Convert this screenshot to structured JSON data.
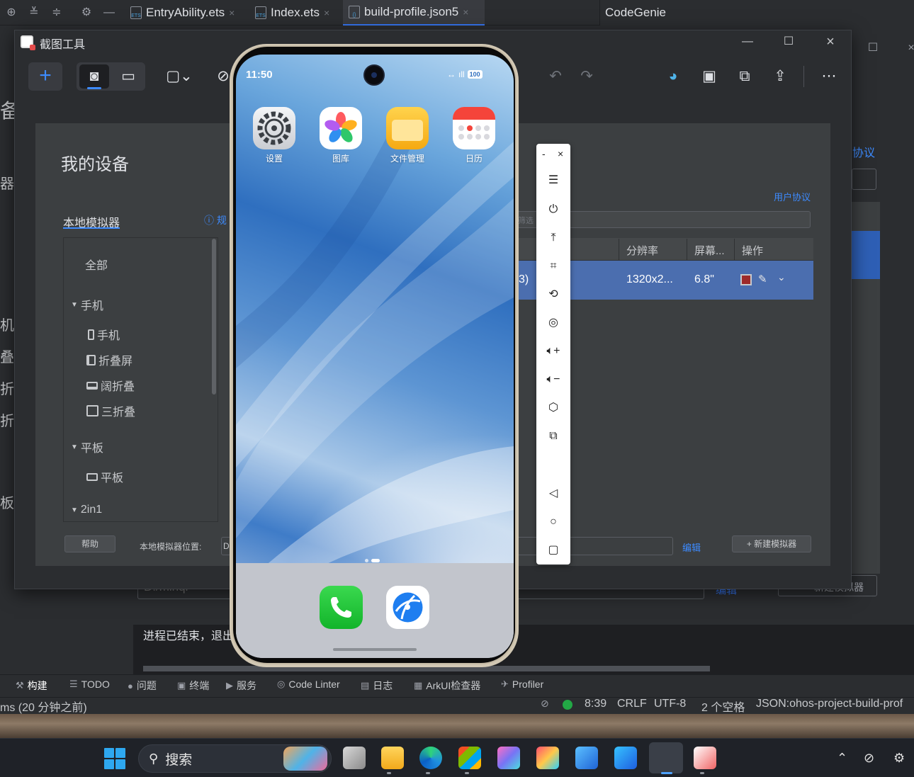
{
  "ide": {
    "tabs": [
      {
        "label": "EntryAbility.ets",
        "active": false
      },
      {
        "label": "Index.ets",
        "active": false
      },
      {
        "label": "build-profile.json5",
        "active": true
      }
    ],
    "right_panel_title": "CodeGenie",
    "tab_icon_badge": "ETS",
    "bg_fragments": {
      "b1": "备",
      "b2": "器",
      "b3": "机",
      "b4": "叠",
      "b5": "折",
      "b6": "折",
      "b7": "板",
      "right_agreement": "协议"
    },
    "bg_location_value": "D:/minqi",
    "bg_edit": "编辑",
    "bg_new": "新建模拟器",
    "console_text": "进程已结束，退出",
    "tool_windows": [
      {
        "icon": "hammer-icon",
        "label": "构建",
        "active": true
      },
      {
        "icon": "list-icon",
        "label": "TODO"
      },
      {
        "icon": "problem-icon",
        "label": "问题"
      },
      {
        "icon": "terminal-icon",
        "label": "终端"
      },
      {
        "icon": "services-icon",
        "label": "服务"
      },
      {
        "icon": "code-linter-icon",
        "label": "Code Linter"
      },
      {
        "icon": "log-icon",
        "label": "日志"
      },
      {
        "icon": "arkui-inspector-icon",
        "label": "ArkUI检查器"
      },
      {
        "icon": "profiler-icon",
        "label": "Profiler"
      }
    ],
    "status": {
      "left": "ms (20 分钟之前)",
      "position": "8:39",
      "line_ending": "CRLF",
      "encoding": "UTF-8",
      "indent": "2 个空格",
      "schema": "JSON:ohos-project-build-prof"
    }
  },
  "snip_tool": {
    "title": "截图工具",
    "toolbar": {
      "new": "+",
      "tools": [
        "camera-icon",
        "video-icon",
        "snip-mode-icon",
        "delay-icon",
        "undo-icon",
        "redo-icon",
        "paint-icon",
        "save-icon",
        "copy-icon",
        "share-icon",
        "more-icon"
      ]
    }
  },
  "device_manager": {
    "title": "我的设备",
    "tab": "本地模拟器",
    "help_link": "规",
    "user_agreement": "用户协议",
    "filter_placeholder": "筛选",
    "tree": {
      "all": "全部",
      "groups": [
        {
          "label": "手机",
          "items": [
            "手机",
            "折叠屏",
            "阔折叠",
            "三折叠"
          ]
        },
        {
          "label": "平板",
          "items": [
            "平板"
          ]
        },
        {
          "label": "2in1",
          "items": []
        }
      ]
    },
    "table": {
      "columns": [
        "分辨率",
        "屏幕...",
        "操作"
      ],
      "row": {
        "name_fragment": "3)",
        "resolution": "1320x2...",
        "screen": "6.8\""
      }
    },
    "help_button": "帮助",
    "location_label": "本地模拟器位置:",
    "location_value": "D",
    "edit": "编辑",
    "new_button": "+ 新建模拟器"
  },
  "phone": {
    "time": "11:50",
    "battery": "100",
    "apps": [
      {
        "label": "设置",
        "icon": "settings-icon"
      },
      {
        "label": "图库",
        "icon": "gallery-icon"
      },
      {
        "label": "文件管理",
        "icon": "files-icon"
      },
      {
        "label": "日历",
        "icon": "calendar-icon"
      }
    ],
    "dock": [
      "phone-icon",
      "browser-icon"
    ]
  },
  "emulator_toolbar": {
    "top": [
      "-",
      "×"
    ],
    "buttons": [
      "menu-icon",
      "power-icon",
      "pin-top-icon",
      "crop-icon",
      "rotate-icon",
      "screen-record-icon",
      "volume-up-icon",
      "volume-down-icon",
      "shake-icon",
      "fold-icon",
      "back-icon",
      "home-icon",
      "recents-icon"
    ]
  },
  "taskbar": {
    "search": "搜索",
    "apps": [
      "task-view-icon",
      "file-explorer-icon",
      "edge-icon",
      "store-icon",
      "app-icon-1",
      "app-icon-2",
      "app-icon-3",
      "app-icon-4",
      "deveco-icon",
      "snipping-tool-icon"
    ]
  },
  "colors": {
    "accent": "#3d8bff",
    "ide_bg": "#2b2d30",
    "panel_bg": "#3c3f41",
    "selection": "#4b6eaf",
    "phone_green": "#1ec735"
  }
}
